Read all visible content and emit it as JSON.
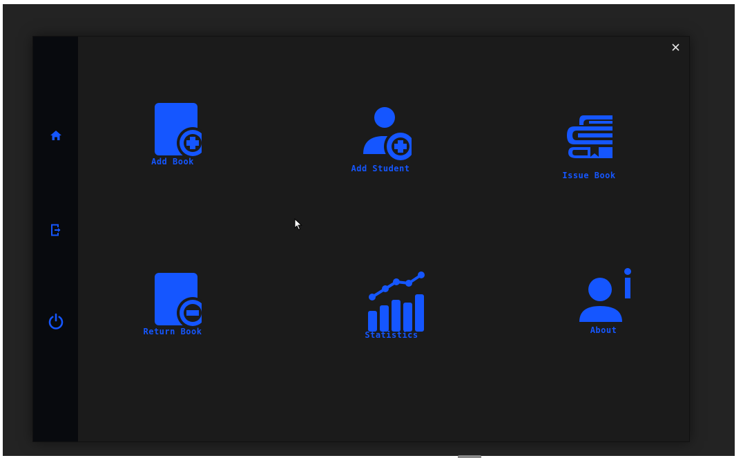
{
  "window": {
    "close_label": "×"
  },
  "sidebar": {
    "items": [
      {
        "name": "home",
        "icon": "home-icon"
      },
      {
        "name": "logout",
        "icon": "logout-icon"
      },
      {
        "name": "power",
        "icon": "power-icon"
      }
    ]
  },
  "tiles": {
    "add_book": {
      "label": "Add Book",
      "icon": "add-book-icon"
    },
    "add_student": {
      "label": "Add Student",
      "icon": "add-student-icon"
    },
    "issue_book": {
      "label": "Issue Book",
      "icon": "books-stack-icon"
    },
    "return_book": {
      "label": "Return Book",
      "icon": "return-book-icon"
    },
    "statistics": {
      "label": "Statistics",
      "icon": "statistics-chart-icon"
    },
    "about": {
      "label": "About",
      "icon": "about-user-info-icon"
    }
  },
  "colors": {
    "accent": "#1556ff",
    "window_bg": "#1b1b1b",
    "sidebar_bg": "#080a0e",
    "desktop_bg": "#232323"
  }
}
